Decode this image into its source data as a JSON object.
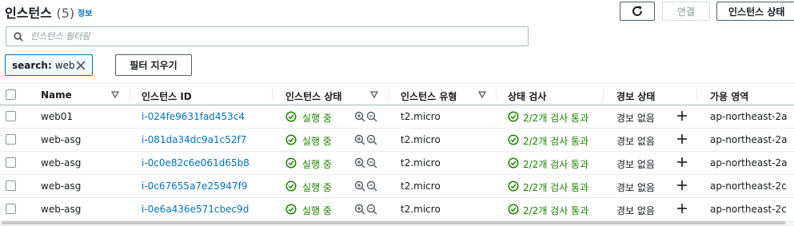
{
  "header": {
    "title": "인스턴스",
    "count": "(5)",
    "info": "정보",
    "connect_label": "연결",
    "state_label": "인스턴스 상태"
  },
  "search": {
    "placeholder": "인스턴스 필터링",
    "value": ""
  },
  "filter_token": {
    "key": "search:",
    "value": "web"
  },
  "clear_filters_label": "필터 지우기",
  "columns": [
    "Name",
    "인스턴스 ID",
    "인스턴스 상태",
    "인스턴스 유형",
    "상태 검사",
    "경보 상태",
    "가용 영역"
  ],
  "rows": [
    {
      "name": "web01",
      "id": "i-024fe9631fad453c4",
      "state": "실행 중",
      "type": "t2.micro",
      "check": "2/2개 검사 통과",
      "alarm": "경보 없음",
      "az": "ap-northeast-2a"
    },
    {
      "name": "web-asg",
      "id": "i-081da34dc9a1c52f7",
      "state": "실행 중",
      "type": "t2.micro",
      "check": "2/2개 검사 통과",
      "alarm": "경보 없음",
      "az": "ap-northeast-2a"
    },
    {
      "name": "web-asg",
      "id": "i-0c0e82c6e061d65b8",
      "state": "실행 중",
      "type": "t2.micro",
      "check": "2/2개 검사 통과",
      "alarm": "경보 없음",
      "az": "ap-northeast-2a"
    },
    {
      "name": "web-asg",
      "id": "i-0c67655a7e25947f9",
      "state": "실행 중",
      "type": "t2.micro",
      "check": "2/2개 검사 통과",
      "alarm": "경보 없음",
      "az": "ap-northeast-2c"
    },
    {
      "name": "web-asg",
      "id": "i-0e6a436e571cbec9d",
      "state": "실행 중",
      "type": "t2.micro",
      "check": "2/2개 검사 통과",
      "alarm": "경보 없음",
      "az": "ap-northeast-2c"
    }
  ],
  "colors": {
    "link": "#0073bb",
    "success": "#1d8102",
    "border": "#aab7b8",
    "text": "#16191f",
    "token_bg": "#f1faff"
  },
  "icons": {
    "refresh": "refresh-icon",
    "search": "search-icon",
    "close": "close-icon",
    "sort": "sort-down-icon",
    "status": "check-circle-icon",
    "zoom_in": "zoom-in-icon",
    "zoom_out": "zoom-out-icon",
    "add": "plus-icon"
  }
}
